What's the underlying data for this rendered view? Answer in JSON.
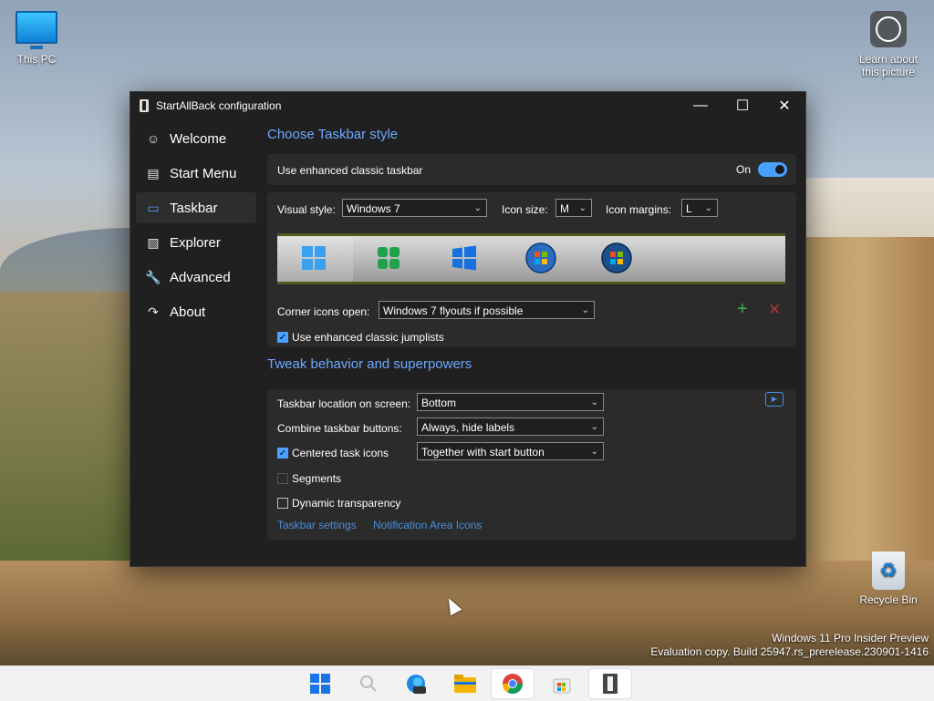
{
  "desktop": {
    "icons": [
      {
        "label": "This PC"
      },
      {
        "label": "Learn about this picture"
      },
      {
        "label": "Recycle Bin"
      }
    ],
    "watermark": {
      "line1": "Windows 11 Pro Insider Preview",
      "line2": "Evaluation copy. Build 25947.rs_prerelease.230901-1416"
    }
  },
  "window": {
    "title": "StartAllBack configuration",
    "controls": {
      "minimize": "—",
      "maximize": "☐",
      "close": "✕"
    }
  },
  "sidebar": {
    "items": [
      {
        "label": "Welcome",
        "icon": "☺"
      },
      {
        "label": "Start Menu",
        "icon": "▤"
      },
      {
        "label": "Taskbar",
        "icon": "▭",
        "active": true
      },
      {
        "label": "Explorer",
        "icon": "▨"
      },
      {
        "label": "Advanced",
        "icon": "🔧"
      },
      {
        "label": "About",
        "icon": "↷"
      }
    ]
  },
  "taskbar_style": {
    "section_title": "Choose Taskbar style",
    "enhanced_label": "Use enhanced classic taskbar",
    "enhanced_state": "On",
    "visual_style_label": "Visual style:",
    "visual_style_value": "Windows 7",
    "icon_size_label": "Icon size:",
    "icon_size_value": "M",
    "icon_margins_label": "Icon margins:",
    "icon_margins_value": "L",
    "corner_label": "Corner icons open:",
    "corner_value": "Windows 7 flyouts if possible",
    "jumplists_label": "Use enhanced classic jumplists",
    "jumplists_checked": true
  },
  "tweak": {
    "section_title": "Tweak behavior and superpowers",
    "location_label": "Taskbar location on screen:",
    "location_value": "Bottom",
    "combine_label": "Combine taskbar buttons:",
    "combine_value": "Always, hide labels",
    "centered_label": "Centered task icons",
    "centered_checked": true,
    "centered_value": "Together with start button",
    "segments_label": "Segments",
    "dynamic_label": "Dynamic transparency",
    "link1": "Taskbar settings",
    "link2": "Notification Area Icons"
  },
  "colors": {
    "accent": "#4aa0ff",
    "link": "#4a8fdd",
    "section_title": "#6ea8ff",
    "window_bg": "#202020",
    "card_bg": "#2b2b2b"
  }
}
